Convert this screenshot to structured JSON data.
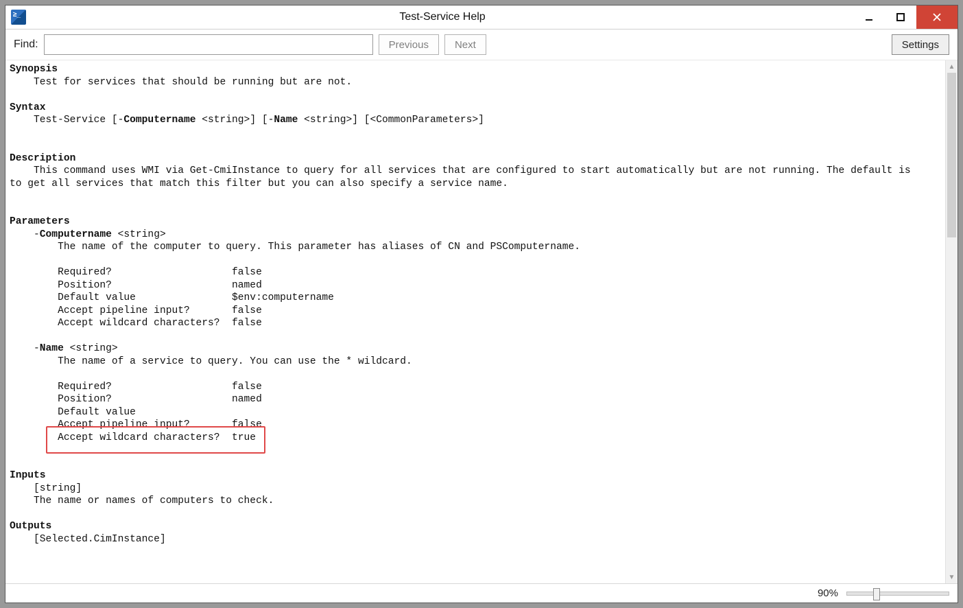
{
  "window": {
    "title": "Test-Service Help"
  },
  "toolbar": {
    "find_label": "Find:",
    "find_value": "",
    "find_placeholder": "",
    "previous_label": "Previous",
    "next_label": "Next",
    "settings_label": "Settings"
  },
  "help": {
    "synopsis_heading": "Synopsis",
    "synopsis_text": "Test for services that should be running but are not.",
    "syntax_heading": "Syntax",
    "syntax_prefix": "Test-Service [-",
    "syntax_p1": "Computername",
    "syntax_mid1": " <string>] [-",
    "syntax_p2": "Name",
    "syntax_mid2": " <string>] [<CommonParameters>]",
    "description_heading": "Description",
    "description_text": "This command uses WMI via Get-CmiInstance to query for all services that are configured to start automatically but are not running. The default is\nto get all services that match this filter but you can also specify a service name.",
    "parameters_heading": "Parameters",
    "p1_dash": "-",
    "p1_name": "Computername",
    "p1_type": " <string>",
    "p1_desc": "The name of the computer to query. This parameter has aliases of CN and PSComputername.",
    "p1_r1": "Required?                    false",
    "p1_r2": "Position?                    named",
    "p1_r3": "Default value                $env:computername",
    "p1_r4": "Accept pipeline input?       false",
    "p1_r5": "Accept wildcard characters?  false",
    "p2_dash": "-",
    "p2_name": "Name",
    "p2_type": " <string>",
    "p2_desc": "The name of a service to query. You can use the * wildcard.",
    "p2_r1": "Required?                    false",
    "p2_r2": "Position?                    named",
    "p2_r3": "Default value",
    "p2_r4": "Accept pipeline input?       false",
    "p2_r5": "Accept wildcard characters?  true",
    "inputs_heading": "Inputs",
    "inputs_type": "[string]",
    "inputs_text": "The name or names of computers to check.",
    "outputs_heading": "Outputs",
    "outputs_type": "[Selected.CimInstance]"
  },
  "status": {
    "zoom_label": "90%"
  }
}
